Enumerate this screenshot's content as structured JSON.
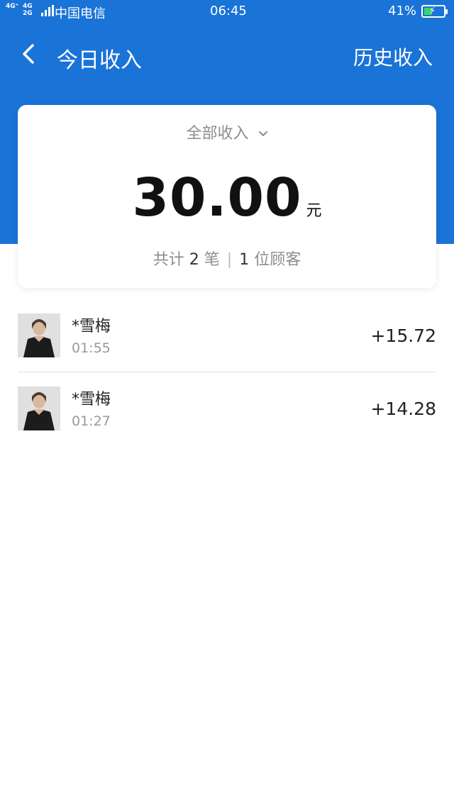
{
  "status_bar": {
    "net_top": "4G⁺",
    "net_mid": "4G",
    "net_bottom": "2G",
    "carrier": "中国电信",
    "time": "06:45",
    "battery": "41%",
    "battery_level": 0.41
  },
  "nav": {
    "title": "今日收入",
    "history_label": "历史收入"
  },
  "summary": {
    "filter_label": "全部收入",
    "amount": "30.00",
    "unit": "元",
    "stats_prefix": "共计",
    "count": "2",
    "count_unit": "笔",
    "separator": "|",
    "customers": "1",
    "customers_unit": "位顾客"
  },
  "transactions": [
    {
      "name": "*雪梅",
      "time": "01:55",
      "amount": "+15.72"
    },
    {
      "name": "*雪梅",
      "time": "01:27",
      "amount": "+14.28"
    }
  ],
  "colors": {
    "header_blue": "#1a73d7",
    "battery_green": "#3fd46a"
  }
}
